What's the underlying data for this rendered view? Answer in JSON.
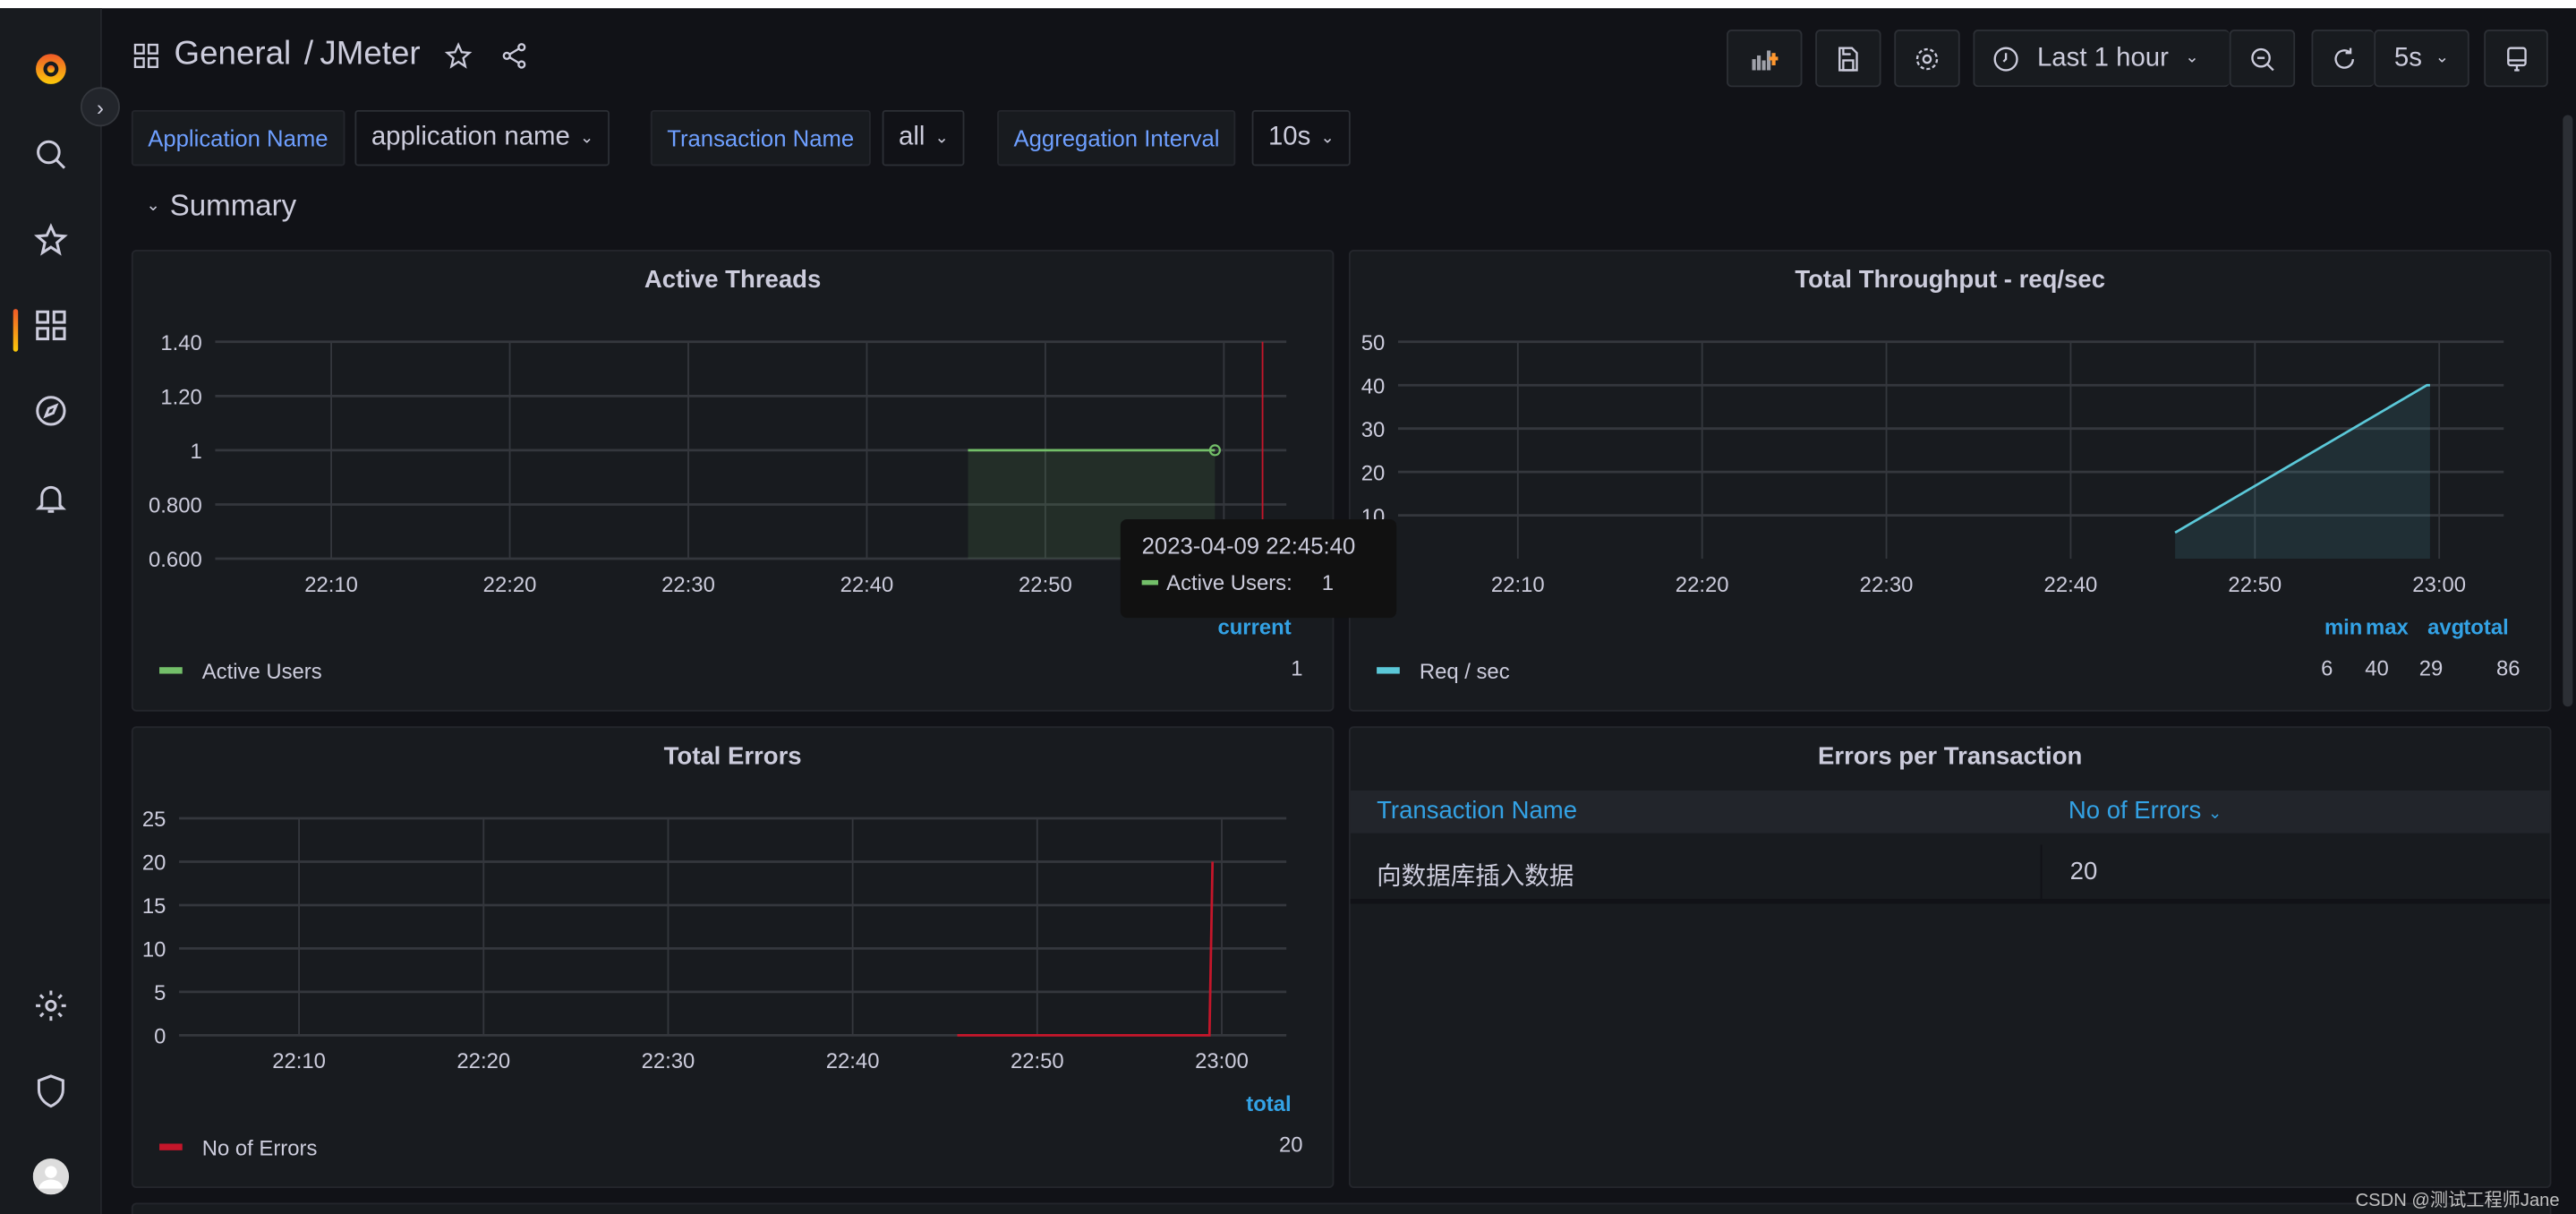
{
  "header": {
    "breadcrumb_folder": "General",
    "breadcrumb_sep": "/",
    "dashboard_title": "JMeter",
    "time_range": "Last 1 hour",
    "refresh_interval": "5s"
  },
  "variables": [
    {
      "label": "Application Name",
      "value": "application name"
    },
    {
      "label": "Transaction Name",
      "value": "all"
    },
    {
      "label": "Aggregation Interval",
      "value": "10s"
    }
  ],
  "row_title": "Summary",
  "panels": {
    "active_threads": {
      "title": "Active Threads",
      "legend_header": "current",
      "legend_name": "Active Users",
      "legend_value": "1",
      "tooltip": {
        "time": "2023-04-09 22:45:40",
        "series": "Active Users:",
        "value": "1"
      }
    },
    "throughput": {
      "title": "Total Throughput - req/sec",
      "legend_headers": [
        "min",
        "max",
        "avg",
        "total"
      ],
      "legend_name": "Req / sec",
      "legend_values": [
        "6",
        "40",
        "29",
        "86"
      ]
    },
    "errors": {
      "title": "Total Errors",
      "legend_header": "total",
      "legend_name": "No of Errors",
      "legend_value": "20"
    },
    "errors_table": {
      "title": "Errors per Transaction",
      "columns": [
        "Transaction Name",
        "No of Errors"
      ],
      "rows": [
        [
          "向数据库插入数据",
          "20"
        ]
      ]
    }
  },
  "chart_data": [
    {
      "type": "area",
      "title": "Active Threads",
      "x_range": [
        "22:03:30",
        "23:03:30"
      ],
      "x_ticks": [
        "22:10",
        "22:20",
        "22:30",
        "22:40",
        "22:50",
        "23:00"
      ],
      "ylim": [
        0.6,
        1.4
      ],
      "y_ticks": [
        "0.600",
        "0.800",
        "1",
        "1.20",
        "1.40"
      ],
      "y_tick_values": [
        0.6,
        0.8,
        1,
        1.2,
        1.4
      ],
      "grid": true,
      "legend_placement": "bottom",
      "series": [
        {
          "name": "Active Users",
          "color": "#73bf69",
          "x": [
            "22:45:40",
            "22:59:30"
          ],
          "values": [
            1,
            1
          ]
        }
      ],
      "annotation_time": "23:02:10",
      "annotation_color": "#c4162a"
    },
    {
      "type": "area",
      "title": "Total Throughput - req/sec",
      "x_range": [
        "22:03:30",
        "23:03:30"
      ],
      "x_ticks": [
        "22:10",
        "22:20",
        "22:30",
        "22:40",
        "22:50",
        "23:00"
      ],
      "ylim": [
        0,
        50
      ],
      "y_ticks": [
        "10",
        "20",
        "30",
        "40",
        "50"
      ],
      "y_tick_values": [
        10,
        20,
        30,
        40,
        50
      ],
      "grid": true,
      "legend_placement": "bottom",
      "series": [
        {
          "name": "Req / sec",
          "color": "#5bc8d8",
          "x": [
            "22:45:40",
            "22:59:20",
            "22:59:30"
          ],
          "values": [
            6,
            40,
            40
          ]
        }
      ]
    },
    {
      "type": "line",
      "title": "Total Errors",
      "x_range": [
        "22:03:30",
        "23:03:30"
      ],
      "x_ticks": [
        "22:10",
        "22:20",
        "22:30",
        "22:40",
        "22:50",
        "23:00"
      ],
      "ylim": [
        0,
        25
      ],
      "y_ticks": [
        "0",
        "5",
        "10",
        "15",
        "20",
        "25"
      ],
      "y_tick_values": [
        0,
        5,
        10,
        15,
        20,
        25
      ],
      "grid": true,
      "legend_placement": "bottom",
      "series": [
        {
          "name": "No of Errors",
          "color": "#c4162a",
          "x": [
            "22:45:40",
            "22:59:20",
            "22:59:30"
          ],
          "values": [
            0,
            0,
            20
          ]
        }
      ]
    }
  ],
  "colors": {
    "accent": "#33a2e5",
    "variable_label": "#6e9fff",
    "background": "#111217",
    "panel": "#181b1f"
  },
  "watermark": "CSDN @测试工程师Jane"
}
